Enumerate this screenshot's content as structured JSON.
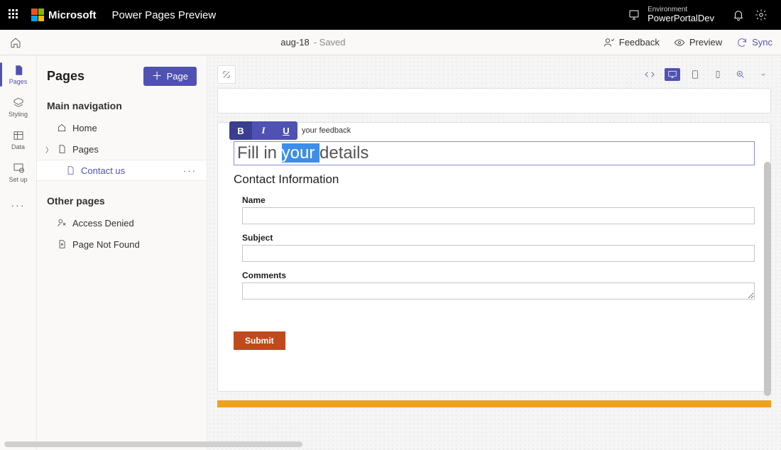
{
  "topbar": {
    "brand": "Microsoft",
    "app_title": "Power Pages Preview",
    "env_label": "Environment",
    "env_value": "PowerPortalDev"
  },
  "cmdbar": {
    "doc_name": "aug-18",
    "doc_status": " - Saved",
    "feedback": "Feedback",
    "preview": "Preview",
    "sync": "Sync"
  },
  "rail": {
    "pages": "Pages",
    "styling": "Styling",
    "data": "Data",
    "setup": "Set up"
  },
  "side": {
    "title": "Pages",
    "add_page_btn": "Page",
    "main_nav_label": "Main navigation",
    "items": {
      "home": "Home",
      "pages": "Pages",
      "contact_us": "Contact us"
    },
    "other_label": "Other pages",
    "other": {
      "access_denied": "Access Denied",
      "page_not_found": "Page Not Found"
    }
  },
  "editor": {
    "float_text": "your feedback",
    "headline_pre": "Fill in ",
    "headline_sel": "your ",
    "headline_post": "details",
    "section_title": "Contact Information",
    "fields": {
      "name_label": "Name",
      "name_value": "",
      "subject_label": "Subject",
      "subject_value": "",
      "comments_label": "Comments",
      "comments_value": ""
    },
    "submit": "Submit"
  }
}
